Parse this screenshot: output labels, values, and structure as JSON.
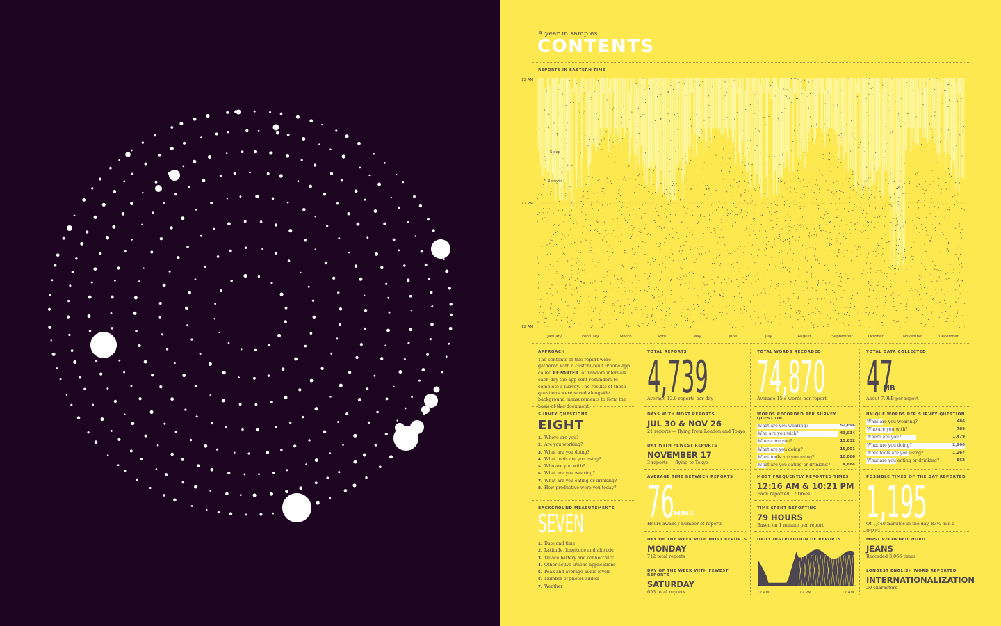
{
  "header": {
    "subtitle": "A year in samples.",
    "title": "CONTENTS"
  },
  "main_chart": {
    "title": "REPORTS IN EASTERN TIME",
    "y_labels": [
      "12 AM",
      "12 PM",
      "12 AM"
    ],
    "months": [
      "January",
      "February",
      "March",
      "April",
      "May",
      "June",
      "July",
      "August",
      "September",
      "October",
      "November",
      "December"
    ],
    "annotations": {
      "sleep": "Sleep",
      "reports": "Reports"
    }
  },
  "approach": {
    "label": "APPROACH",
    "text_before": "The contents of this report were gathered with a custom-built iPhone app called ",
    "app_name": "REPORTER",
    "text_after": ". At random intervals each day the app sent reminders to complete a survey. The results of these questions were saved alongside background measurements to form the basis of this document."
  },
  "survey_questions": {
    "label": "SURVEY QUESTIONS",
    "value": "EIGHT",
    "items": [
      {
        "n": "1.",
        "text": "Where are you?"
      },
      {
        "n": "2.",
        "text": "Are you working?"
      },
      {
        "n": "3.",
        "text": "What are you doing?"
      },
      {
        "n": "4.",
        "text": "What tools are you using?"
      },
      {
        "n": "5.",
        "text": "Who are you with?"
      },
      {
        "n": "6.",
        "text": "What are you wearing?"
      },
      {
        "n": "7.",
        "text": "What are you eating or drinking?"
      },
      {
        "n": "8.",
        "text": "How productive were you today?"
      }
    ]
  },
  "background_measurements": {
    "label": "BACKGROUND MEASUREMENTS",
    "value": "SEVEN",
    "items": [
      {
        "n": "1.",
        "text": "Date and time"
      },
      {
        "n": "2.",
        "text": "Latitude, longitude and altitude"
      },
      {
        "n": "3.",
        "text": "Device battery and connectivity"
      },
      {
        "n": "4.",
        "text": "Other active iPhone applications"
      },
      {
        "n": "5.",
        "text": "Peak and average audio levels"
      },
      {
        "n": "6.",
        "text": "Number of photos added"
      },
      {
        "n": "7.",
        "text": "Weather"
      }
    ]
  },
  "total_reports": {
    "label": "TOTAL REPORTS",
    "value": "4,739",
    "note": "Average 12.9 reports per day"
  },
  "total_words": {
    "label": "TOTAL WORDS RECORDED",
    "value": "74,870",
    "note": "Average 15.8 words per report"
  },
  "total_data": {
    "label": "TOTAL DATA COLLECTED",
    "value": "47",
    "unit": "MB",
    "note": "About 7.9kB per report"
  },
  "days_most": {
    "label": "DAYS WITH MOST REPORTS",
    "value": "JUL 30 & NOV 26",
    "note": "21 reports — flying from London and Tokyo"
  },
  "day_fewest": {
    "label": "DAY WITH FEWEST REPORTS",
    "value": "NOVEMBER 17",
    "note": "3 reports — flying to Tokyo"
  },
  "avg_time": {
    "label": "AVERAGE TIME BETWEEN REPORTS",
    "value": "76",
    "unit": "MINS",
    "note": "Hours awake / number of reports"
  },
  "dow_most": {
    "label": "DAY OF THE WEEK WITH MOST REPORTS",
    "value": "MONDAY",
    "note": "712 total reports"
  },
  "dow_fewest": {
    "label": "DAY OF THE WEEK WITH FEWEST REPORTS",
    "value": "SATURDAY",
    "note": "653 total reports"
  },
  "words_per_question": {
    "label": "WORDS RECORDED PER SURVEY QUESTION",
    "rows": [
      {
        "q": "What are you wearing?",
        "v": "52,696",
        "frac": 1.0
      },
      {
        "q": "Who are you with?",
        "v": "43,934",
        "frac": 0.83
      },
      {
        "q": "Where are you?",
        "v": "15,632",
        "frac": 0.3
      },
      {
        "q": "What are you doing?",
        "v": "15,001",
        "frac": 0.28
      },
      {
        "q": "What tools are you using?",
        "v": "10,066",
        "frac": 0.19
      },
      {
        "q": "What are you eating or drinking?",
        "v": "4,884",
        "frac": 0.09
      }
    ]
  },
  "unique_words": {
    "label": "UNIQUE WORDS PER SURVEY QUESTION",
    "rows": [
      {
        "q": "What are you wearing?",
        "v": "486",
        "frac": 0.17
      },
      {
        "q": "Who are you with?",
        "v": "789",
        "frac": 0.27
      },
      {
        "q": "Where are you?",
        "v": "1,479",
        "frac": 0.51
      },
      {
        "q": "What are you doing?",
        "v": "2,900",
        "frac": 1.0
      },
      {
        "q": "What tools are you using?",
        "v": "1,267",
        "frac": 0.44
      },
      {
        "q": "What are you eating or drinking?",
        "v": "862",
        "frac": 0.3
      }
    ]
  },
  "frequent_times": {
    "label": "MOST FREQUENTLY REPORTED TIMES",
    "value": "12:16 AM & 10:21 PM",
    "note": "Each reported 12 times"
  },
  "time_spent": {
    "label": "TIME SPENT REPORTING",
    "value": "79 HOURS",
    "note": "Based on 1 minute per report"
  },
  "daily_distribution": {
    "label": "DAILY DISTRIBUTION OF REPORTS",
    "x_labels": [
      "12 AM",
      "12 PM",
      "12 AM"
    ]
  },
  "possible_times": {
    "label": "POSSIBLE TIMES OF THE DAY REPORTED",
    "value": "1,195",
    "note": "Of 1,440 minutes in the day, 83% had a report"
  },
  "most_word": {
    "label": "MOST RECORDED WORD",
    "value": "JEANS",
    "note": "Recorded 3,066 times"
  },
  "longest_word": {
    "label": "LONGEST ENGLISH WORD REPORTED",
    "value": "INTERNATIONALIZATION",
    "note": "20 characters"
  },
  "colors": {
    "left_bg": "#1d0522",
    "right_bg": "#fde84f",
    "ink": "#4d4650",
    "light_bar": "#fff8a8"
  }
}
